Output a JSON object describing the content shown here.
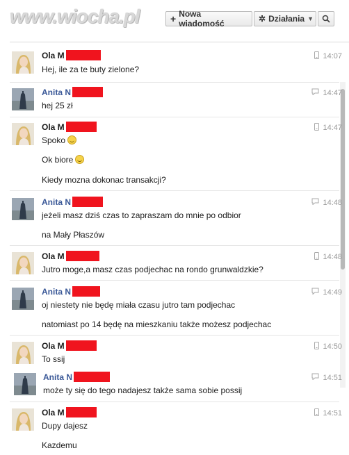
{
  "header": {
    "logo_text": "www.wiocha.pl",
    "new_message_label": "Nowa wiadomość",
    "actions_label": "Działania"
  },
  "messages": [
    {
      "sender": "Ola M",
      "type": "ola",
      "time": "14:07",
      "time_icon": "mobile-icon",
      "lines": [
        "Hej, ile za te buty zielone?"
      ]
    },
    {
      "sender": "Anita N",
      "type": "anita",
      "time": "14:47",
      "time_icon": "chat-bubble-icon",
      "lines": [
        "hej 25 zł"
      ]
    },
    {
      "sender": "Ola M",
      "type": "ola",
      "time": "14:47",
      "time_icon": "mobile-icon",
      "lines": [
        "Spoko",
        "Ok biore",
        "Kiedy mozna dokonac transakcji?"
      ]
    },
    {
      "sender": "Anita N",
      "type": "anita",
      "time": "14:48",
      "time_icon": "chat-bubble-icon",
      "lines": [
        "jeżeli masz dziś czas to zapraszam do mnie po odbior",
        "na Mały Płaszów"
      ]
    },
    {
      "sender": "Ola M",
      "type": "ola",
      "time": "14:48",
      "time_icon": "mobile-icon",
      "lines": [
        "Jutro moge,a masz czas podjechac na rondo grunwaldzkie?"
      ]
    },
    {
      "sender": "Anita N",
      "type": "anita",
      "time": "14:49",
      "time_icon": "chat-bubble-icon",
      "lines": [
        "oj niestety nie będę miała czasu jutro tam podjechac",
        "natomiast po 14 będę na mieszkaniu także możesz podjechac"
      ]
    },
    {
      "sender": "Ola M",
      "type": "ola",
      "time": "14:50",
      "time_icon": "mobile-icon",
      "lines": [
        "To ssij"
      ]
    },
    {
      "sender": "Anita N",
      "type": "anita",
      "time": "14:51",
      "time_icon": "chat-bubble-icon",
      "lines": [
        "może ty się do tego nadajesz także sama sobie possij"
      ]
    },
    {
      "sender": "Ola M",
      "type": "ola",
      "time": "14:51",
      "time_icon": "mobile-icon",
      "lines": [
        "Dupy dajesz",
        "Kazdemu"
      ]
    }
  ],
  "colors": {
    "redaction": "#f0141e",
    "anita_name": "#3b5998"
  }
}
